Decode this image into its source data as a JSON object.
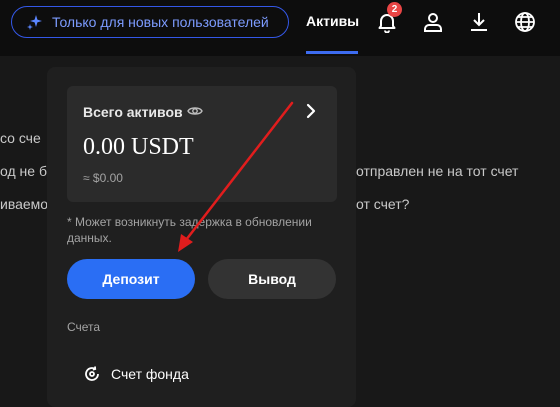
{
  "header": {
    "promo_label": "Только для новых пользователей",
    "active_tab": "Активы",
    "notification_count": "2"
  },
  "background": {
    "lines": [
      "со сче",
      "од не б",
      "отправлен не на тот счет",
      "иваемо",
      "от счет?"
    ]
  },
  "assets_panel": {
    "title": "Всего активов",
    "balance": "0.00 USDT",
    "approx_value": "≈ $0.00",
    "note": "* Может возникнуть задержка в обновлении данных.",
    "deposit_label": "Депозит",
    "withdraw_label": "Вывод",
    "accounts_label": "Счета",
    "fund_account_label": "Счет фонда"
  },
  "colors": {
    "accent": "#2a6ef4",
    "promo_border": "#3458e8",
    "annotation_arrow": "#e11d1d",
    "badge": "#e94545"
  }
}
